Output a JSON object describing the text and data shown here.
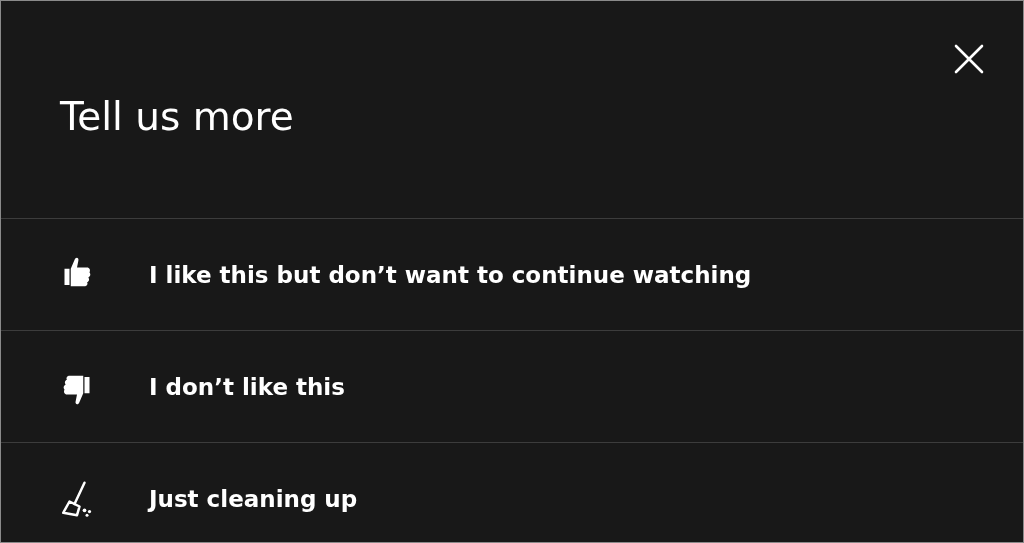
{
  "dialog": {
    "title": "Tell us more"
  },
  "options": [
    {
      "kind": "like",
      "label": "I like this but don’t want to continue watching"
    },
    {
      "kind": "dislike",
      "label": "I don’t like this"
    },
    {
      "kind": "cleanup",
      "label": "Just cleaning up"
    }
  ]
}
